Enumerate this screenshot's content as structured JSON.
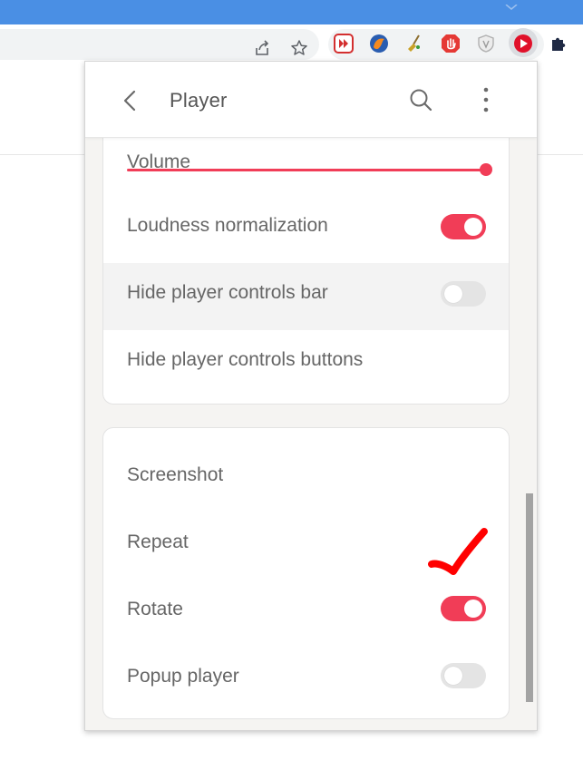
{
  "browser": {
    "icons": [
      "chevron-down-icon",
      "share-icon",
      "star-icon",
      "extension-fast-forward-icon",
      "extension-fox-icon",
      "extension-broom-icon",
      "extension-hand-stop-icon",
      "extension-shield-icon",
      "extension-youtube-player-icon",
      "puzzle-extensions-icon"
    ]
  },
  "colors": {
    "accent": "#f13d57",
    "chrome_blue": "#4a8fe4",
    "popup_bg": "#f5f4f2"
  },
  "popup": {
    "title": "Player",
    "header_icons": [
      "back-arrow-icon",
      "search-icon",
      "more-vert-icon"
    ],
    "sections": [
      {
        "volume_label": "Volume",
        "volume_level_percent": 100,
        "rows": [
          {
            "label": "Loudness normalization",
            "toggle": "on"
          },
          {
            "label": "Hide player controls bar",
            "toggle": "off"
          },
          {
            "label": "Hide player controls buttons"
          }
        ]
      },
      {
        "rows": [
          {
            "label": "Screenshot"
          },
          {
            "label": "Repeat"
          },
          {
            "label": "Rotate",
            "toggle": "on"
          },
          {
            "label": "Popup player",
            "toggle": "off"
          }
        ]
      }
    ]
  },
  "annotation": {
    "icon": "red-checkmark-icon",
    "color": "#ff0000"
  }
}
